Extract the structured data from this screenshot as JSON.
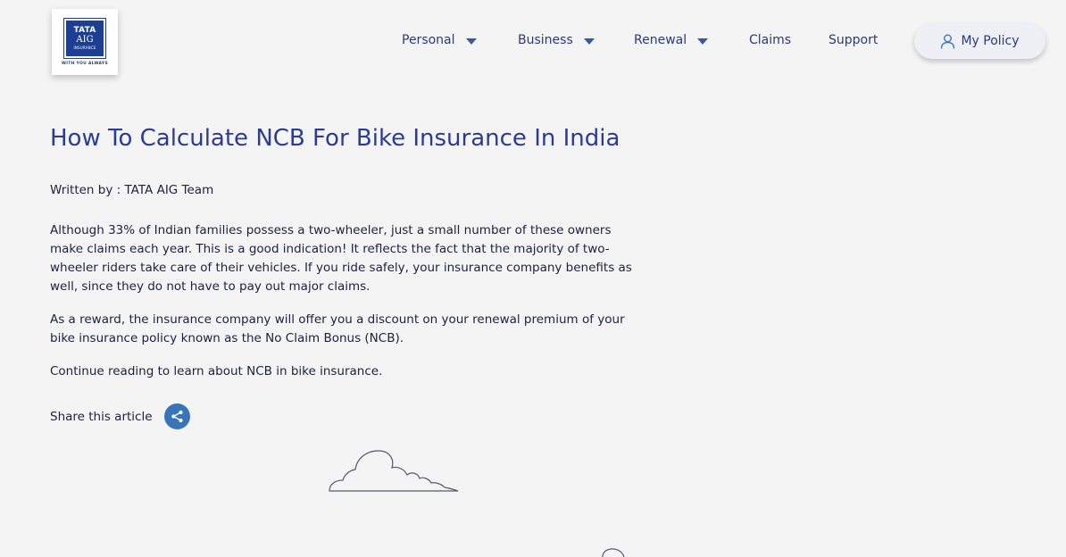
{
  "header": {
    "logo": {
      "brand": "TATA",
      "sub": "AIG",
      "kind": "INSURANCE",
      "tagline": "WITH YOU ALWAYS"
    },
    "nav": [
      {
        "label": "Personal",
        "dropdown": true
      },
      {
        "label": "Business",
        "dropdown": true
      },
      {
        "label": "Renewal",
        "dropdown": true
      },
      {
        "label": "Claims",
        "dropdown": false
      },
      {
        "label": "Support",
        "dropdown": false
      }
    ],
    "my_policy": {
      "label": "My Policy",
      "icon": "user-icon"
    }
  },
  "article": {
    "title": "How To Calculate NCB For Bike Insurance In India",
    "author": "Written by : TATA AIG Team",
    "paragraphs": [
      "Although 33% of Indian families possess a two-wheeler, just a small number of these owners make claims each year. This is a good indication! It reflects the fact that the majority of two-wheeler riders take care of their vehicles. If you ride safely, your insurance company benefits as well, since they do not have to pay out major claims.",
      "As a reward, the insurance company will offer you a discount on your renewal premium of your bike insurance policy known as the No Claim Bonus (NCB).",
      "Continue reading to learn about NCB in bike insurance."
    ],
    "share_label": "Share this article"
  },
  "colors": {
    "title": "#2d3c93",
    "nav": "#2b3a78",
    "share_button": "#3a74b8",
    "logo_blue": "#1c3f94",
    "background": "#f4f4f4"
  }
}
